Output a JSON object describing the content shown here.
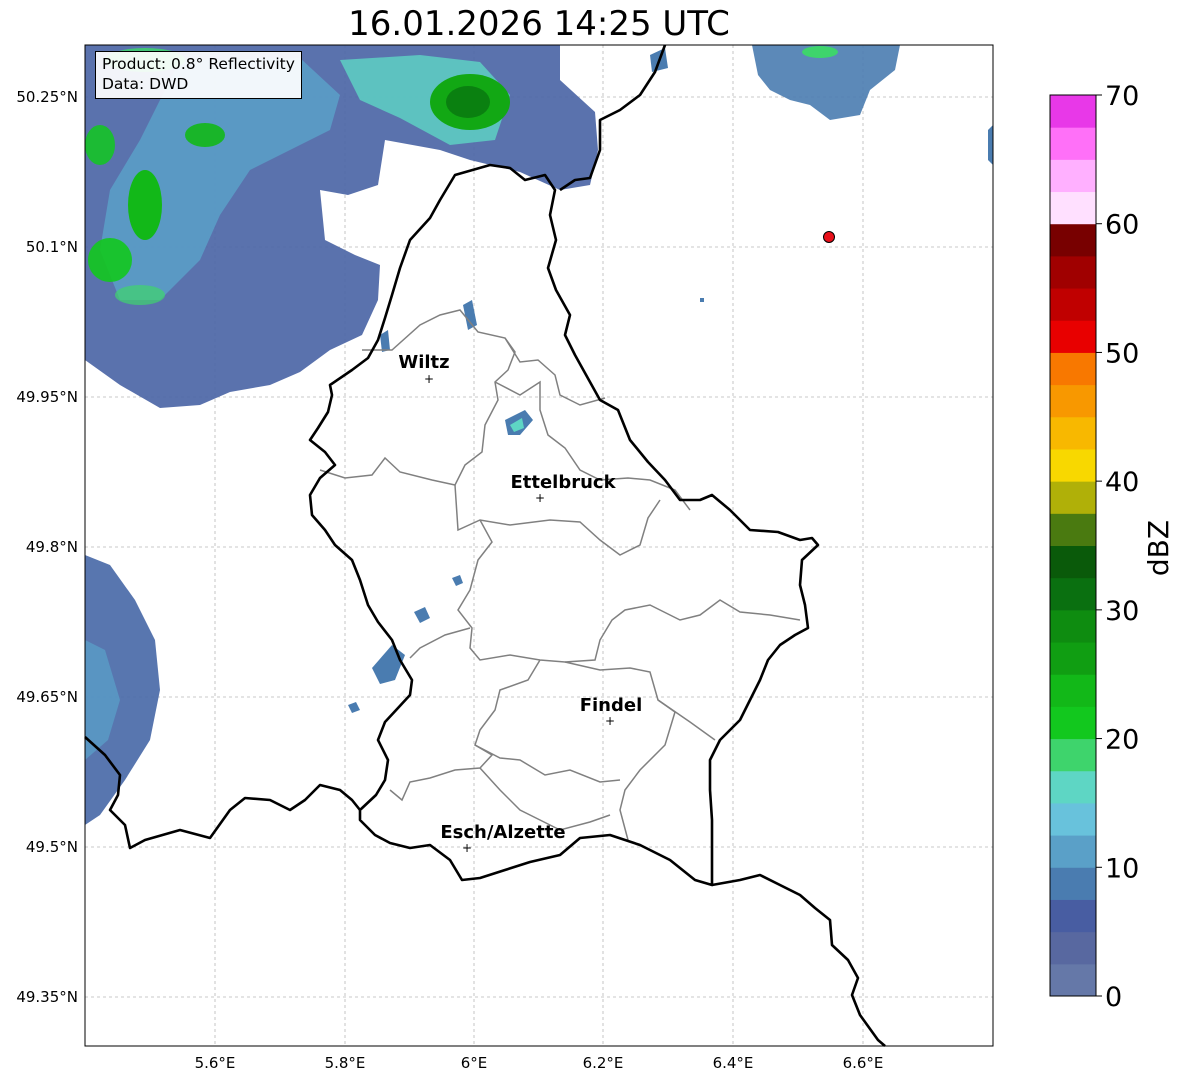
{
  "title": "16.01.2026 14:25 UTC",
  "info": {
    "product": "Product: 0.8° Reflectivity",
    "source": "Data: DWD"
  },
  "lat_labels": [
    "50.25°N",
    "50.1°N",
    "49.95°N",
    "49.8°N",
    "49.65°N",
    "49.5°N",
    "49.35°N"
  ],
  "lon_labels": [
    "5.6°E",
    "5.8°E",
    "6°E",
    "6.2°E",
    "6.4°E",
    "6.6°E"
  ],
  "cities": [
    {
      "name": "Wiltz"
    },
    {
      "name": "Ettelbruck"
    },
    {
      "name": "Findel"
    },
    {
      "name": "Esch/Alzette"
    }
  ],
  "radar_marker_color": "#e8101a",
  "colorbar": {
    "label": "dBZ",
    "ticks": [
      "0",
      "10",
      "20",
      "30",
      "40",
      "50",
      "60",
      "70"
    ],
    "colors": [
      "#6578a8",
      "#5868a0",
      "#485da2",
      "#4a7cb0",
      "#5aa0c8",
      "#68c2dc",
      "#5ed6c4",
      "#3ed46c",
      "#12c81e",
      "#12b818",
      "#109e12",
      "#0e8c10",
      "#0a7010",
      "#0a5a0a",
      "#4a7a10",
      "#b0b008",
      "#f8d800",
      "#f8b800",
      "#f89800",
      "#f87800",
      "#e80000",
      "#c00000",
      "#a00000",
      "#780000",
      "#ffe0ff",
      "#ffb0ff",
      "#ff70f8",
      "#e838e8"
    ]
  }
}
